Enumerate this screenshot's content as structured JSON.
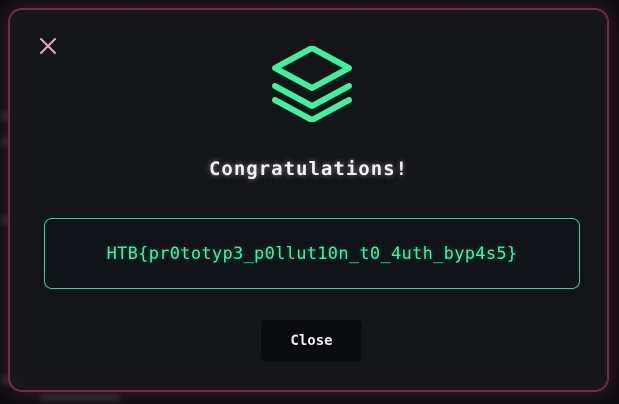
{
  "modal": {
    "title": "Congratulations!",
    "flag": "HTB{pr0totyp3_p0llut10n_t0_4uth_byp4s5}",
    "close_button_label": "Close"
  },
  "icons": {
    "close": "close-icon",
    "logo": "stacked-layers-icon"
  },
  "colors": {
    "accent": "#3ff2a0",
    "border": "#6b2e45",
    "background": "#14151a"
  }
}
